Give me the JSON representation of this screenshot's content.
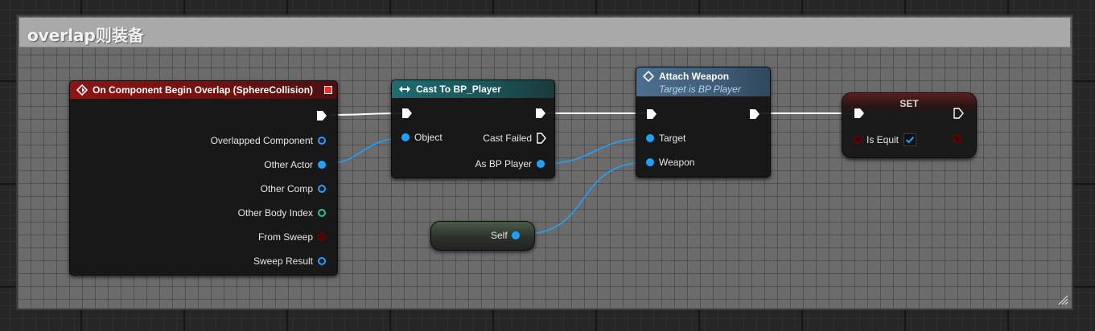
{
  "comment": {
    "title": "overlap则装备"
  },
  "event_node": {
    "title": "On Component Begin Overlap (SphereCollision)",
    "pins": [
      {
        "label": "Overlapped Component",
        "kind": "hollow",
        "color": "#1fa2ff"
      },
      {
        "label": "Other Actor",
        "kind": "filled",
        "color": "#1fa2ff"
      },
      {
        "label": "Other Comp",
        "kind": "hollow",
        "color": "#1fa2ff"
      },
      {
        "label": "Other Body Index",
        "kind": "green-hollow",
        "color": "#25c48b"
      },
      {
        "label": "From Sweep",
        "kind": "dark-red",
        "color": "#6b0000"
      },
      {
        "label": "Sweep Result",
        "kind": "hollow",
        "color": "#1fa2ff"
      }
    ]
  },
  "cast_node": {
    "title": "Cast To BP_Player",
    "object_label": "Object",
    "cast_failed_label": "Cast Failed",
    "as_label": "As BP Player"
  },
  "attach_node": {
    "title": "Attach Weapon",
    "subtitle": "Target is BP Player",
    "target_label": "Target",
    "weapon_label": "Weapon"
  },
  "set_node": {
    "title": "SET",
    "var_label": "Is Equit",
    "checked": true
  },
  "self_node": {
    "label": "Self"
  },
  "colors": {
    "event_header": "#8c1515",
    "cast_header": "#1e6b70",
    "function_header": "#4c6f8f",
    "object_pin": "#1fa2ff",
    "int_pin": "#25c48b",
    "bool_pin": "#6b0000",
    "exec_wire": "#ffffff"
  }
}
